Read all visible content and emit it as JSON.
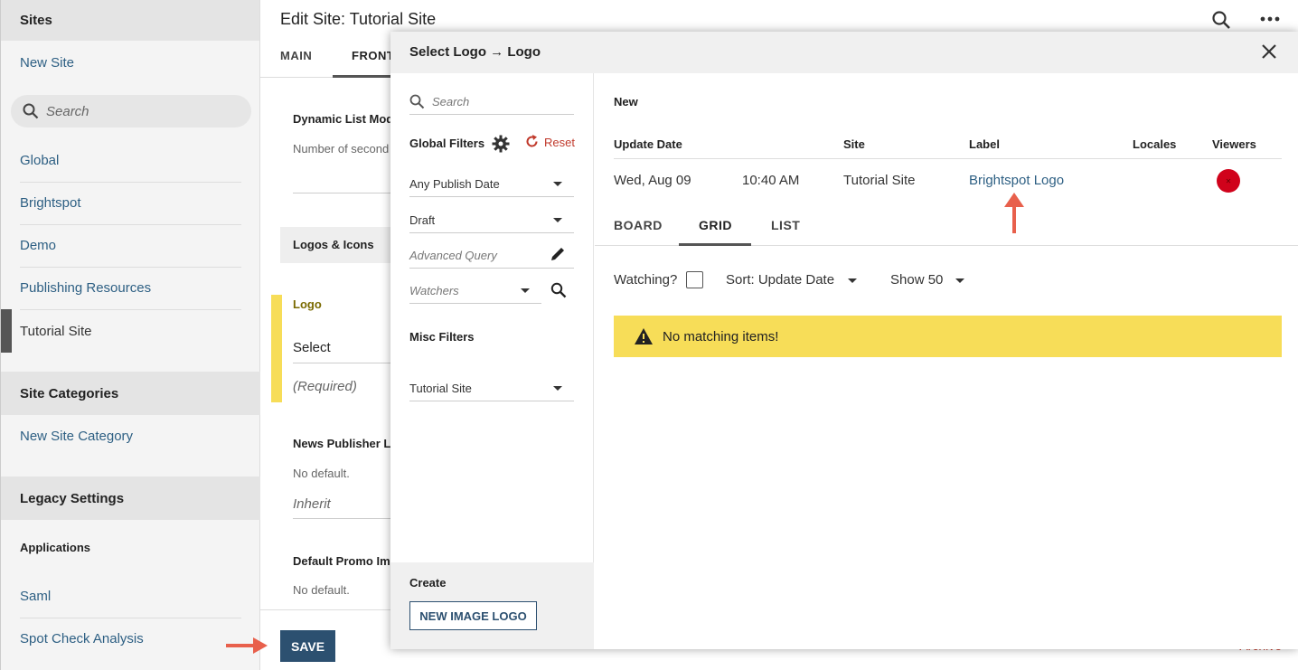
{
  "sidebar": {
    "sites_header": "Sites",
    "new_site": "New Site",
    "search_placeholder": "Search",
    "items": [
      "Global",
      "Brightspot",
      "Demo",
      "Publishing Resources",
      "Tutorial Site"
    ],
    "site_categories_header": "Site Categories",
    "new_site_category": "New Site Category",
    "legacy_header": "Legacy Settings",
    "applications_label": "Applications",
    "apps": [
      "Saml",
      "Spot Check Analysis"
    ]
  },
  "main": {
    "title": "Edit Site: Tutorial Site",
    "tabs": [
      "MAIN",
      "FRONT-"
    ],
    "dynamic_list_label": "Dynamic List Mod",
    "dynamic_list_help": "Number of second",
    "logos_icons": "Logos & Icons",
    "logo_label": "Logo",
    "logo_select": "Select",
    "logo_required": "(Required)",
    "news_publisher_label": "News Publisher L",
    "news_publisher_default": "No default.",
    "news_publisher_value": "Inherit",
    "default_promo_label": "Default Promo Im",
    "default_promo_default": "No default.",
    "save": "SAVE",
    "archive": "Archive"
  },
  "modal": {
    "title": "Select Logo → Logo",
    "filters": {
      "search_placeholder": "Search",
      "global_filters": "Global Filters",
      "reset": "Reset",
      "publish_date": "Any Publish Date",
      "status": "Draft",
      "advanced_query": "Advanced Query",
      "watchers": "Watchers",
      "misc_filters": "Misc Filters",
      "site": "Tutorial Site",
      "create_label": "Create",
      "new_image_logo": "NEW IMAGE LOGO"
    },
    "results": {
      "section_label": "New",
      "columns": [
        "Update Date",
        "Site",
        "Label",
        "Locales",
        "Viewers"
      ],
      "row": {
        "date": "Wed, Aug 09",
        "time": "10:40 AM",
        "site": "Tutorial Site",
        "label": "Brightspot Logo"
      },
      "tabs": [
        "BOARD",
        "GRID",
        "LIST"
      ],
      "watching": "Watching?",
      "sort": "Sort: Update Date",
      "show": "Show 50",
      "no_items": "No matching items!"
    }
  },
  "colors": {
    "link": "#2d5f83",
    "warning": "#f7dd58",
    "save_button": "#2c5070",
    "annotation_arrow": "#e8604c",
    "reset": "#c0392b"
  }
}
